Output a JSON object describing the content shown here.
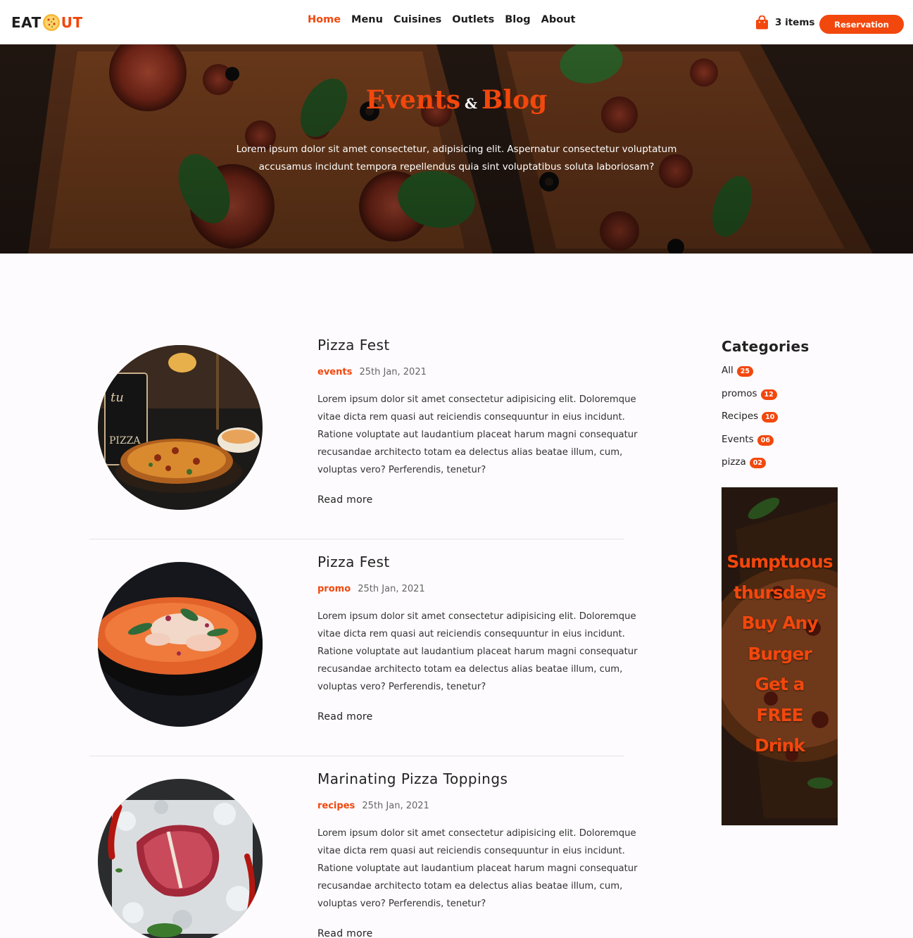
{
  "brand": {
    "left": "EAT",
    "right": "UT"
  },
  "nav": {
    "links": [
      "Home",
      "Menu",
      "Cuisines",
      "Outlets",
      "Blog",
      "About"
    ],
    "active": "Home"
  },
  "cart": {
    "label": "3 items",
    "icon": "shopping-bag-icon"
  },
  "reservation_label": "Reservation",
  "hero": {
    "title_part1": "Events",
    "title_amp": "&",
    "title_part2": "Blog",
    "subtitle": "Lorem ipsum dolor sit amet consectetur, adipisicing elit. Aspernatur consectetur voluptatum accusamus incidunt tempora repellendus quia sint voluptatibus soluta laboriosam?"
  },
  "posts": [
    {
      "title": "Pizza Fest",
      "category": "events",
      "date": "25th Jan, 2021",
      "excerpt": "Lorem ipsum dolor sit amet consectetur adipisicing elit. Doloremque vitae dicta rem quasi aut reiciendis consequuntur in eius incidunt. Ratione voluptate aut laudantium placeat harum magni consequatur recusandae architecto totam ea delectus alias beatae illum, cum, voluptas vero? Perferendis, tenetur?",
      "read_more": "Read more"
    },
    {
      "title": "Pizza Fest",
      "category": "promo",
      "date": "25th Jan, 2021",
      "excerpt": "Lorem ipsum dolor sit amet consectetur adipisicing elit. Doloremque vitae dicta rem quasi aut reiciendis consequuntur in eius incidunt. Ratione voluptate aut laudantium placeat harum magni consequatur recusandae architecto totam ea delectus alias beatae illum, cum, voluptas vero? Perferendis, tenetur?",
      "read_more": "Read more"
    },
    {
      "title": "Marinating Pizza Toppings",
      "category": "recipes",
      "date": "25th Jan, 2021",
      "excerpt": "Lorem ipsum dolor sit amet consectetur adipisicing elit. Doloremque vitae dicta rem quasi aut reiciendis consequuntur in eius incidunt. Ratione voluptate aut laudantium placeat harum magni consequatur recusandae architecto totam ea delectus alias beatae illum, cum, voluptas vero? Perferendis, tenetur?",
      "read_more": "Read more"
    }
  ],
  "sidebar": {
    "title": "Categories",
    "categories": [
      {
        "name": "All",
        "count": "25"
      },
      {
        "name": "promos",
        "count": "12"
      },
      {
        "name": "Recipes",
        "count": "10"
      },
      {
        "name": "Events",
        "count": "06"
      },
      {
        "name": "pizza",
        "count": "02"
      }
    ],
    "promo_lines": [
      "Sumptuous",
      "thursdays",
      "Buy Any",
      "Burger",
      "Get a",
      "FREE",
      "Drink"
    ]
  },
  "colors": {
    "accent": "#f2470d",
    "text": "#222222",
    "background": "#fdfbfd"
  }
}
